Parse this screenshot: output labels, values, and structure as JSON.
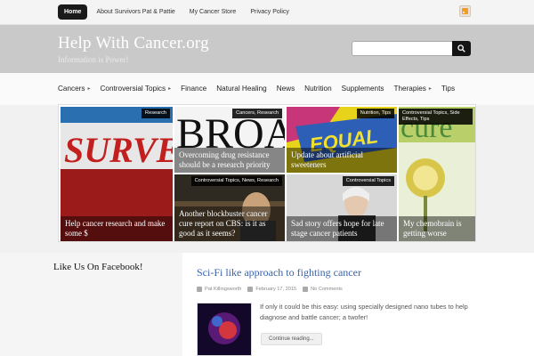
{
  "topnav": {
    "items": [
      {
        "label": "Home",
        "active": true
      },
      {
        "label": "About Survivors Pat & Pattie",
        "active": false
      },
      {
        "label": "My Cancer Store",
        "active": false
      },
      {
        "label": "Privacy Policy",
        "active": false
      }
    ],
    "rss_icon": "rss-icon"
  },
  "header": {
    "title": "Help With Cancer.org",
    "tagline": "Information is Power!",
    "search": {
      "placeholder": "",
      "icon": "search-icon"
    }
  },
  "mainnav": {
    "items": [
      {
        "label": "Cancers",
        "has_submenu": true
      },
      {
        "label": "Controversial Topics",
        "has_submenu": true
      },
      {
        "label": "Finance",
        "has_submenu": false
      },
      {
        "label": "Natural Healing",
        "has_submenu": false
      },
      {
        "label": "News",
        "has_submenu": false
      },
      {
        "label": "Nutrition",
        "has_submenu": false
      },
      {
        "label": "Supplements",
        "has_submenu": false
      },
      {
        "label": "Therapies",
        "has_submenu": true
      },
      {
        "label": "Tips",
        "has_submenu": false
      }
    ]
  },
  "featured": {
    "tiles": [
      {
        "tag": "Research",
        "caption": "Help cancer research and make some $",
        "art": "SURVEY SAYS"
      },
      {
        "tag": "Cancers, Research",
        "caption": "Overcoming drug resistance should be a research priority",
        "art": "BROA"
      },
      {
        "tag": "Nutrition, Tips",
        "caption": "Update about artificial sweeteners",
        "art": "EQUAL"
      },
      {
        "tag": "Controversial Topics, Side Effects, Tips",
        "caption": "My chemobrain is getting worse",
        "art": "cure"
      },
      {
        "tag": "Controversial Topics, News, Research",
        "caption": "Another blockbuster cancer cure report on CBS: is it as good as it seems?",
        "art": ""
      },
      {
        "tag": "Controversial Topics",
        "caption": "Sad story offers hope for late stage cancer patients",
        "art": ""
      }
    ]
  },
  "sidebar": {
    "title": "Like Us On Facebook!"
  },
  "post": {
    "title": "Sci-Fi like approach to fighting cancer",
    "author": "Pat Killingsworth",
    "date": "February 17, 2015",
    "comments": "No Comments",
    "excerpt": "If only it could be this easy: using specially designed nano tubes to help diagnose and battle cancer; a twofer!",
    "more_label": "Continue reading..."
  }
}
